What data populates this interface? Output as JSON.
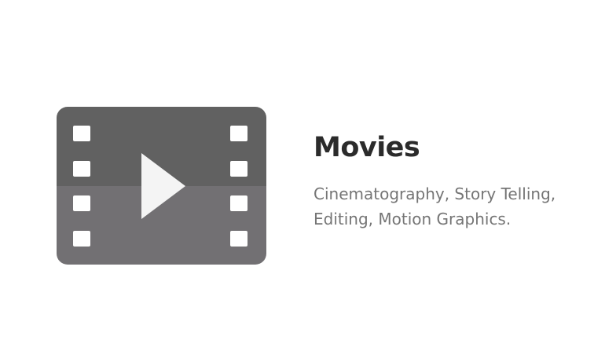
{
  "card": {
    "icon": "film-play-icon",
    "title": "Movies",
    "description_lines": [
      "Cinematography, Story Telling,",
      "Editing, Motion Graphics."
    ]
  },
  "colors": {
    "icon_top": "#616161",
    "icon_bottom": "#727073",
    "icon_holes": "#ffffff",
    "play_triangle": "#f4f4f4",
    "title": "#2b2b2b",
    "description": "#757575",
    "background": "#ffffff"
  }
}
